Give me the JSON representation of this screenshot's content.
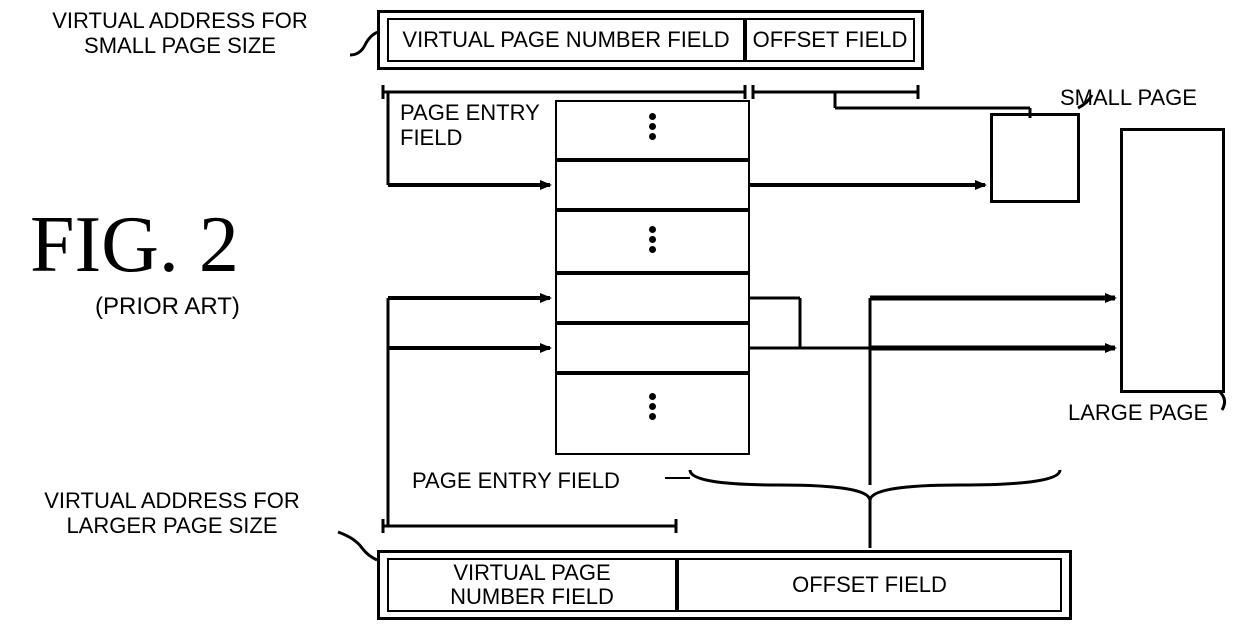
{
  "figure": {
    "title": "FIG. 2",
    "subtitle": "(PRIOR ART)"
  },
  "labels": {
    "topLeft": "VIRTUAL ADDRESS FOR\nSMALL PAGE SIZE",
    "bottomLeft": "VIRTUAL ADDRESS FOR\nLARGER PAGE SIZE",
    "pageEntryTop": "PAGE ENTRY\nFIELD",
    "pageEntryBottom": "PAGE ENTRY  FIELD",
    "smallPage": "SMALL PAGE",
    "largePage": "LARGE PAGE"
  },
  "topAddress": {
    "vpn": "VIRTUAL PAGE NUMBER FIELD",
    "offset": "OFFSET FIELD"
  },
  "bottomAddress": {
    "vpn": "VIRTUAL PAGE\nNUMBER FIELD",
    "offset": "OFFSET FIELD"
  }
}
